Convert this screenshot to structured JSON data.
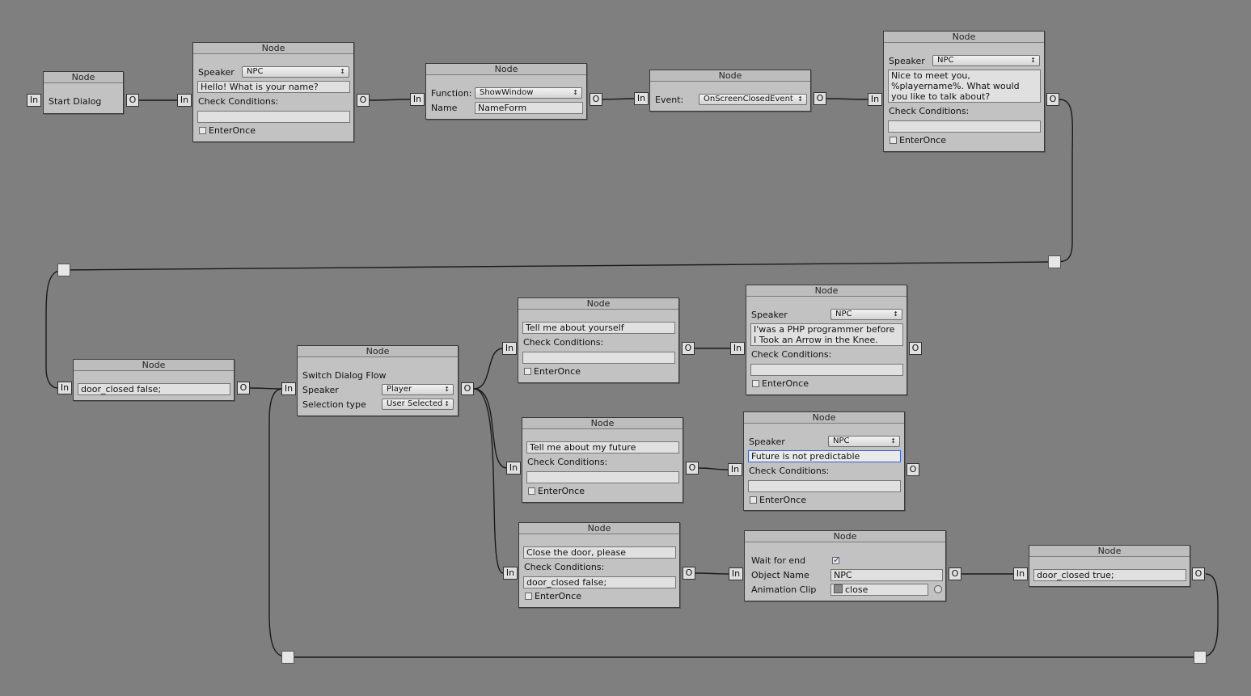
{
  "node_title": "Node",
  "port_in": "In",
  "port_out": "O",
  "labels": {
    "speaker": "Speaker",
    "check_conditions": "Check Conditions:",
    "enter_once": "EnterOnce",
    "function": "Function:",
    "name": "Name",
    "event": "Event:",
    "switch_flow": "Switch Dialog Flow",
    "selection_type": "Selection type",
    "wait_for_end": "Wait for end",
    "object_name": "Object Name",
    "animation_clip": "Animation Clip"
  },
  "nodes": {
    "start": {
      "label": "Start Dialog"
    },
    "greet": {
      "speaker": "NPC",
      "text": "Hello! What is your name?",
      "conditions": "",
      "enter_once": false
    },
    "func": {
      "function": "ShowWindow",
      "name": "NameForm"
    },
    "event": {
      "event": "OnScreenClosedEvent"
    },
    "meet": {
      "speaker": "NPC",
      "text": "Nice to meet you, %playername%. What would you like to talk about?",
      "conditions": "",
      "enter_once": false
    },
    "door_set": {
      "code": "door_closed false;"
    },
    "switch": {
      "speaker": "Player",
      "selection_type": "User Selected"
    },
    "opt1": {
      "text": "Tell me about yourself",
      "conditions": "",
      "enter_once": false
    },
    "resp1": {
      "speaker": "NPC",
      "text": "I'was a PHP programmer before I Took an Arrow in the Knee.",
      "conditions": "",
      "enter_once": false
    },
    "opt2": {
      "text": "Tell me about my future",
      "conditions": "",
      "enter_once": false
    },
    "resp2": {
      "speaker": "NPC",
      "text": "Future is not predictable",
      "conditions": "",
      "enter_once": false
    },
    "opt3": {
      "text": "Close the door, please",
      "conditions": "door_closed false;",
      "enter_once": false
    },
    "anim": {
      "wait_for_end": true,
      "object_name": "NPC",
      "clip": "close"
    },
    "door_end": {
      "code": "door_closed true;"
    }
  }
}
